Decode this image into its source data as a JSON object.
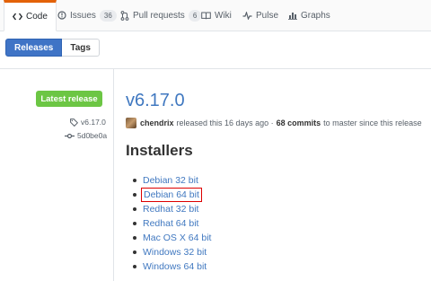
{
  "tabs": [
    {
      "label": "Code",
      "icon": "code-icon",
      "selected": true
    },
    {
      "label": "Issues",
      "icon": "issue-icon",
      "count": "36"
    },
    {
      "label": "Pull requests",
      "icon": "pull-request-icon",
      "count": "6"
    },
    {
      "label": "Wiki",
      "icon": "book-icon"
    },
    {
      "label": "Pulse",
      "icon": "pulse-icon"
    },
    {
      "label": "Graphs",
      "icon": "graph-icon"
    }
  ],
  "subnav": {
    "releases": "Releases",
    "tags": "Tags"
  },
  "sidebar": {
    "latest": "Latest release",
    "tag": "v6.17.0",
    "commit": "5d0be0a"
  },
  "release": {
    "title": "v6.17.0",
    "author": "chendrix",
    "released_text": "released this 16 days ago ·",
    "commits": "68 commits",
    "since_text": "to master since this release"
  },
  "installers": {
    "heading": "Installers",
    "items": [
      "Debian 32 bit",
      "Debian 64 bit",
      "Redhat 32 bit",
      "Redhat 64 bit",
      "Mac OS X 64 bit",
      "Windows 32 bit",
      "Windows 64 bit"
    ],
    "highlighted_index": 1
  },
  "colors": {
    "accent": "#e36209",
    "link": "#4078c0",
    "latest": "#6cc644",
    "button": "#3f74c6",
    "highlight": "#dd0000"
  }
}
